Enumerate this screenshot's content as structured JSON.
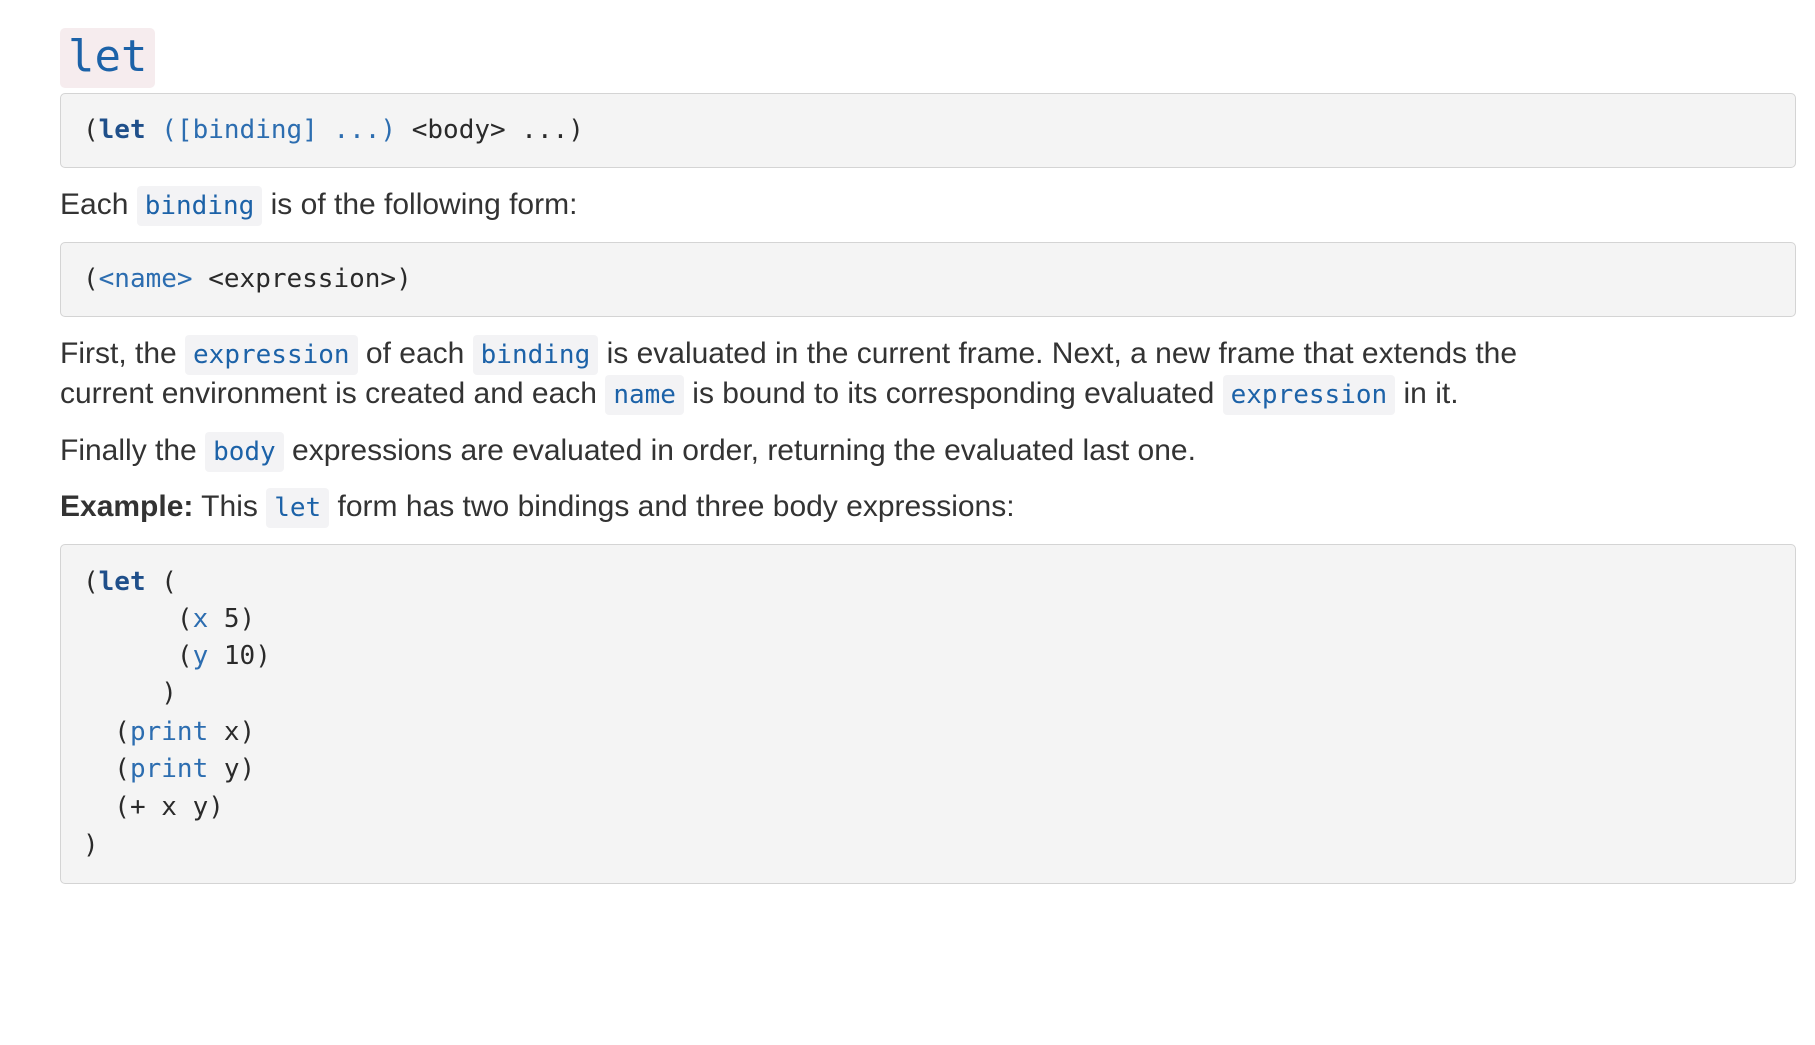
{
  "heading": "let",
  "syntax": {
    "open": "(",
    "kw": "let",
    "binding_part": " ([binding] ...) ",
    "body_part": "<body> ...)"
  },
  "binding_intro": {
    "pre": "Each ",
    "code": "binding",
    "post": " is of the following form:"
  },
  "binding_form": {
    "open": "(",
    "name": "<name>",
    "rest": " <expression>)"
  },
  "para1": {
    "t1": "First, the ",
    "c1": "expression",
    "t2": " of each ",
    "c2": "binding",
    "t3": " is evaluated in the current frame. Next, a new frame that extends the",
    "t4": "current environment is created and each ",
    "c3": "name",
    "t5": " is bound to its corresponding evaluated ",
    "c4": "expression",
    "t6": " in it."
  },
  "para2": {
    "t1": "Finally the ",
    "c1": "body",
    "t2": " expressions are evaluated in order, returning the evaluated last one."
  },
  "example": {
    "label": "Example:",
    "t1": " This ",
    "c1": "let",
    "t2": " form has two bindings and three body expressions:"
  },
  "example_code": {
    "l1_open": "(",
    "l1_kw": "let",
    "l1_rest": " (",
    "l2_open": "      (",
    "l2_var": "x",
    "l2_rest": " 5)",
    "l3_open": "      (",
    "l3_var": "y",
    "l3_rest": " 10)",
    "l4": "     )",
    "l5_open": "  (",
    "l5_var": "print",
    "l5_rest": " x)",
    "l6_open": "  (",
    "l6_var": "print",
    "l6_rest": " y)",
    "l7": "  (+ x y)",
    "l8": ")"
  }
}
